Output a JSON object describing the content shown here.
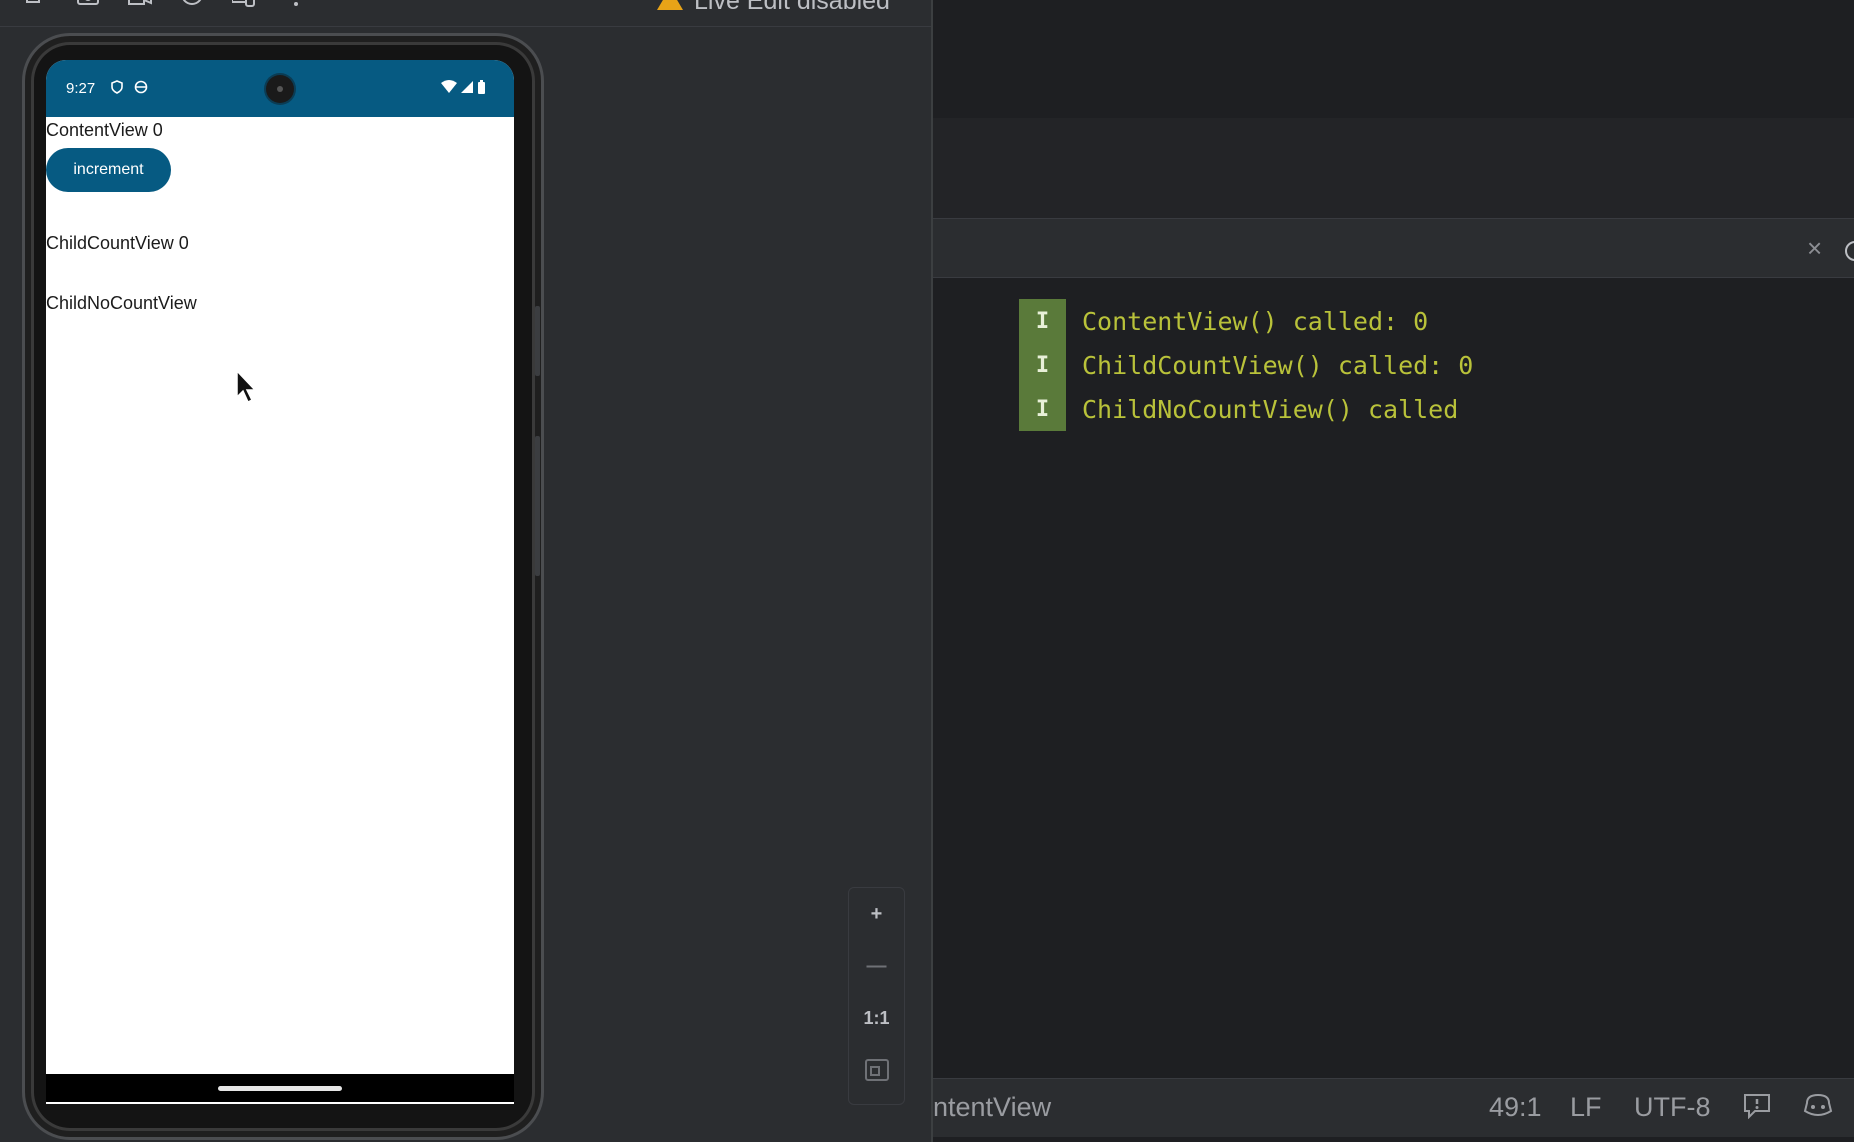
{
  "toolbar": {
    "icons": [
      "back-icon",
      "screenshot-icon",
      "screen-record-icon",
      "info-icon",
      "device-mirror-icon",
      "more-icon"
    ],
    "live_edit_label": "Live Edit disabled",
    "warning_color": "#e8a317"
  },
  "device": {
    "status_time": "9:27",
    "status_color": "#065a82",
    "app": {
      "content_view_text": "ContentView 0",
      "increment_label": "increment",
      "child_count_text": "ChildCountView 0",
      "child_no_count_text": "ChildNoCountView"
    }
  },
  "zoom": {
    "zoom_in": "+",
    "zoom_out": "—",
    "actual_size": "1:1",
    "fit_screen": "fit-screen-icon"
  },
  "logcat": {
    "lines": [
      {
        "level": "I",
        "message": "ContentView() called: 0"
      },
      {
        "level": "I",
        "message": "ChildCountView() called: 0"
      },
      {
        "level": "I",
        "message": "ChildNoCountView() called"
      }
    ],
    "level_color": "#5a7a3a",
    "message_color": "#b9c23a"
  },
  "footer": {
    "breadcrumb": "ntentView",
    "position": "49:1",
    "line_separator": "LF",
    "encoding": "UTF-8"
  }
}
